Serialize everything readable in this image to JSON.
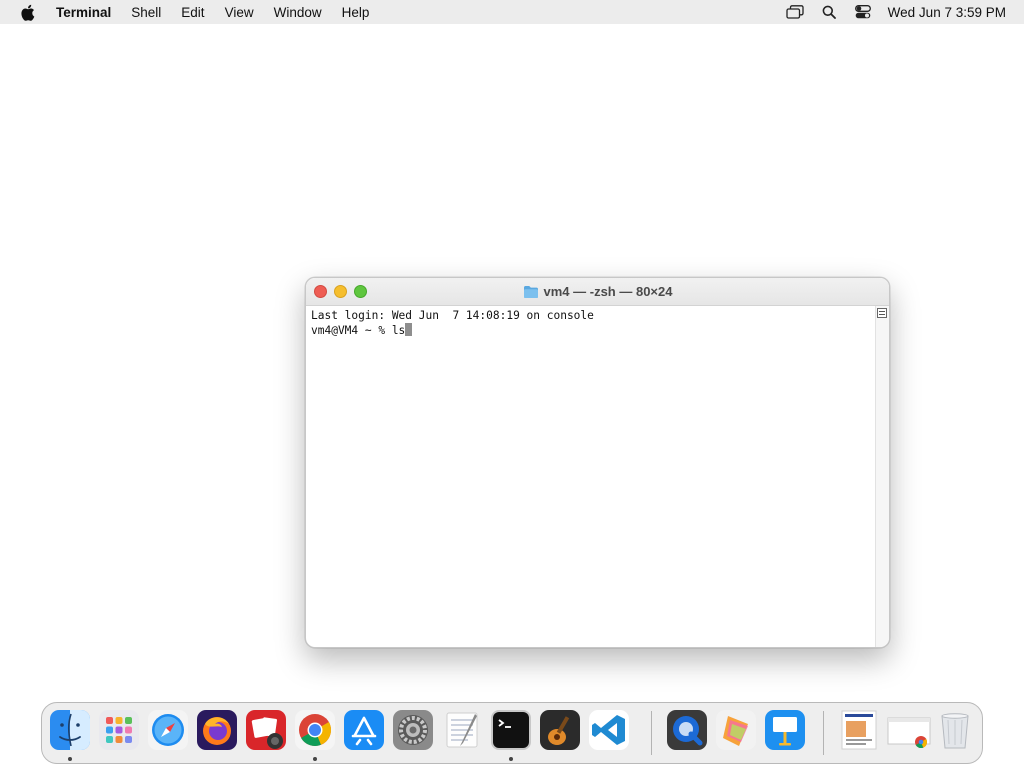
{
  "menubar": {
    "app_name": "Terminal",
    "items": [
      "Shell",
      "Edit",
      "View",
      "Window",
      "Help"
    ],
    "clock": "Wed Jun 7  3:59 PM"
  },
  "window": {
    "title": "vm4 — -zsh — 80×24",
    "lines": [
      "Last login: Wed Jun  7 14:08:19 on console",
      "vm4@VM4 ~ % ls"
    ]
  },
  "dock": {
    "items": [
      {
        "icon": "finder-icon",
        "running": true
      },
      {
        "icon": "launchpad-icon",
        "running": false
      },
      {
        "icon": "safari-icon",
        "running": false
      },
      {
        "icon": "firefox-icon",
        "running": false
      },
      {
        "icon": "photo-booth-icon",
        "running": false
      },
      {
        "icon": "chrome-icon",
        "running": true
      },
      {
        "icon": "app-store-icon",
        "running": false
      },
      {
        "icon": "system-settings-icon",
        "running": false
      },
      {
        "icon": "textedit-icon",
        "running": false
      },
      {
        "icon": "terminal-icon",
        "running": true
      },
      {
        "icon": "garageband-icon",
        "running": false
      },
      {
        "icon": "vscode-icon",
        "running": false
      },
      {
        "icon": "quicktime-icon",
        "running": false
      },
      {
        "icon": "pages-icon",
        "running": false
      },
      {
        "icon": "keynote-icon",
        "running": false
      },
      {
        "icon": "document-thumbnail-icon",
        "running": false
      },
      {
        "icon": "chrome-window-thumbnail-icon",
        "running": false
      },
      {
        "icon": "trash-icon",
        "running": false
      }
    ]
  },
  "colors": {
    "close": "#ee5d54",
    "minimize": "#f5be2e",
    "maximize": "#5fc63f",
    "menubar_bg": "#ececec"
  }
}
